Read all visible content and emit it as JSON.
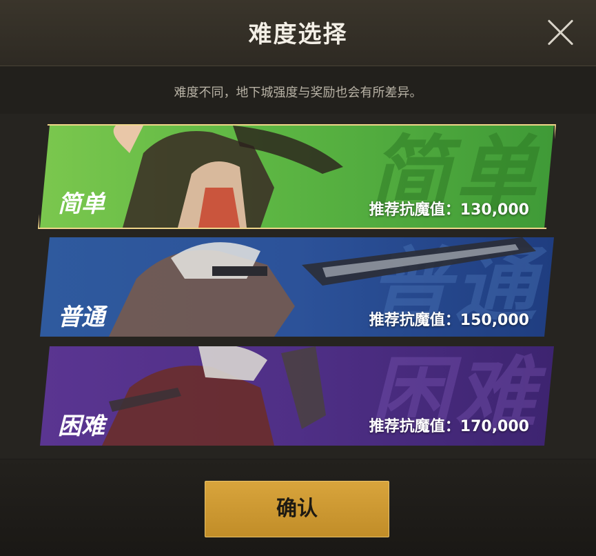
{
  "dialog": {
    "title": "难度选择",
    "subtitle": "难度不同，地下城强度与奖励也会有所差异。",
    "close_icon": "close-icon"
  },
  "difficulties": [
    {
      "label": "简单",
      "bg_text": "简单",
      "power_text": "推荐抗魔值：130,000",
      "color": "#5fb844",
      "selected": true
    },
    {
      "label": "普通",
      "bg_text": "普通",
      "power_text": "推荐抗魔值：150,000",
      "color": "#2c5299",
      "selected": false
    },
    {
      "label": "困难",
      "bg_text": "困难",
      "power_text": "推荐抗魔值：170,000",
      "color": "#4f2f86",
      "selected": false
    }
  ],
  "confirm": {
    "label": "确认",
    "color": "#c8952f"
  }
}
